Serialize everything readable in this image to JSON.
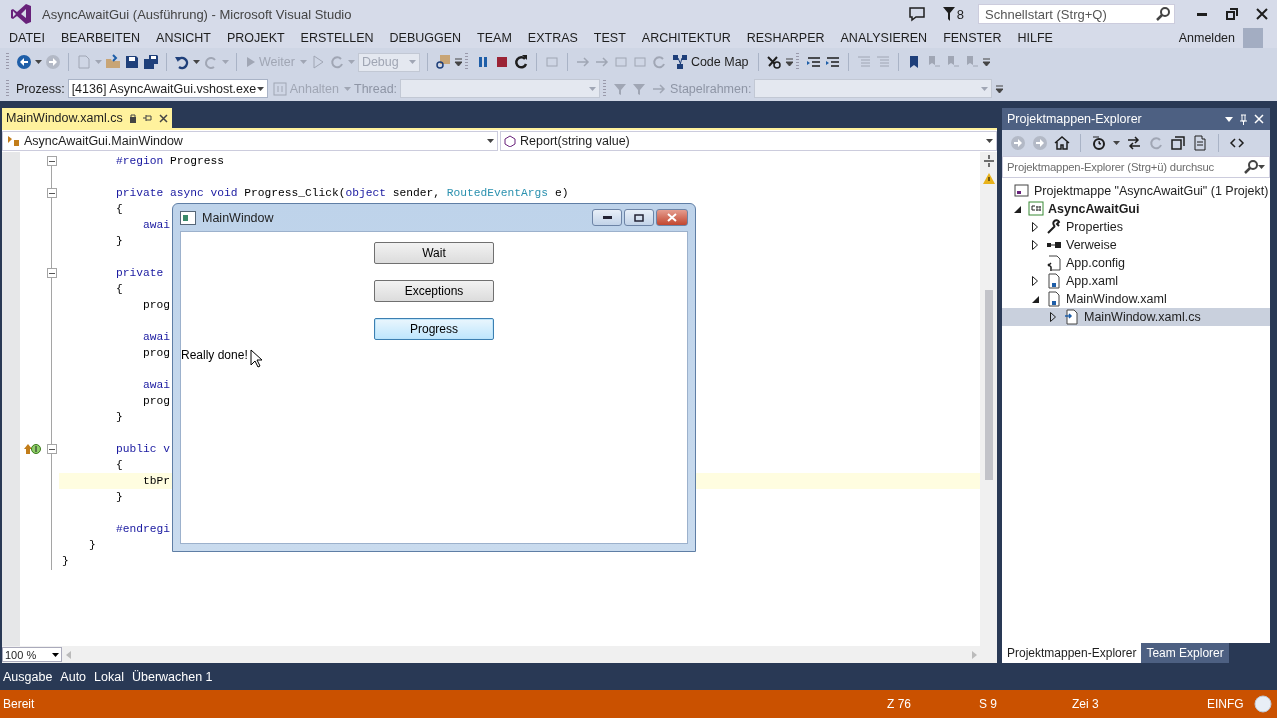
{
  "window": {
    "title": "AsyncAwaitGui (Ausführung) - Microsoft Visual Studio",
    "notification_count": "8",
    "quick_launch": {
      "placeholder": "Schnellstart (Strg+Q)"
    }
  },
  "menu": [
    "DATEI",
    "BEARBEITEN",
    "ANSICHT",
    "PROJEKT",
    "ERSTELLEN",
    "DEBUGGEN",
    "TEAM",
    "EXTRAS",
    "TEST",
    "ARCHITEKTUR",
    "RESHARPER",
    "ANALYSIEREN",
    "FENSTER",
    "HILFE"
  ],
  "account": {
    "label": "Anmelden"
  },
  "toolbar": {
    "continue_button": {
      "label": "Weiter",
      "disabled": true
    },
    "config_combo": {
      "value": "Debug",
      "disabled": true
    },
    "code_map_button": {
      "label": "Code Map",
      "disabled": false
    }
  },
  "debug_location": {
    "process_label": "Prozess:",
    "process_combo": "[4136] AsyncAwaitGui.vshost.exe",
    "suspend_button": {
      "label": "Anhalten",
      "disabled": true
    },
    "thread_label": "Thread:",
    "stack_frame_label": "Stapelrahmen:"
  },
  "editor": {
    "tab": {
      "title": "MainWindow.xaml.cs",
      "selected": true
    },
    "type_combo": "AsyncAwaitGui.MainWindow",
    "member_combo": "Report(string value)",
    "zoom": "100 %",
    "lines": [
      {
        "tokens": [
          {
            "kind": "keyword",
            "text": "        #region"
          },
          {
            "kind": "plain",
            "text": " Progress"
          }
        ],
        "fold": true,
        "highlighted": false
      },
      {
        "tokens": [
          {
            "kind": "keyword",
            "text": "        private async void"
          },
          {
            "kind": "plain",
            "text": " Progress_Click("
          },
          {
            "kind": "keyword",
            "text": "object"
          },
          {
            "kind": "plain",
            "text": " sender, "
          },
          {
            "kind": "type",
            "text": "RoutedEventArgs"
          },
          {
            "kind": "plain",
            "text": " e)"
          }
        ],
        "fold": true,
        "highlighted": false,
        "space_before": true
      },
      {
        "tokens": [
          {
            "kind": "plain",
            "text": "        {"
          }
        ],
        "fold": false,
        "highlighted": false
      },
      {
        "tokens": [
          {
            "kind": "keyword",
            "text": "            awai"
          }
        ],
        "fold": false,
        "highlighted": false
      },
      {
        "tokens": [
          {
            "kind": "plain",
            "text": "        }"
          }
        ],
        "fold": false,
        "highlighted": false
      },
      {
        "tokens": [
          {
            "kind": "keyword",
            "text": "        private"
          }
        ],
        "fold": true,
        "highlighted": false,
        "space_before": true
      },
      {
        "tokens": [
          {
            "kind": "plain",
            "text": "        {"
          }
        ],
        "fold": false,
        "highlighted": false
      },
      {
        "tokens": [
          {
            "kind": "plain",
            "text": "            prog"
          }
        ],
        "fold": false,
        "highlighted": false
      },
      {
        "tokens": [
          {
            "kind": "keyword",
            "text": "            awai"
          }
        ],
        "fold": false,
        "highlighted": false,
        "space_before": true
      },
      {
        "tokens": [
          {
            "kind": "plain",
            "text": "            prog"
          }
        ],
        "fold": false,
        "highlighted": false
      },
      {
        "tokens": [
          {
            "kind": "keyword",
            "text": "            awai"
          }
        ],
        "fold": false,
        "highlighted": false,
        "space_before": true
      },
      {
        "tokens": [
          {
            "kind": "plain",
            "text": "            prog"
          }
        ],
        "fold": false,
        "highlighted": false
      },
      {
        "tokens": [
          {
            "kind": "plain",
            "text": "        }"
          }
        ],
        "fold": false,
        "highlighted": false
      },
      {
        "tokens": [
          {
            "kind": "keyword",
            "text": "        public v"
          }
        ],
        "fold": true,
        "highlighted": false,
        "implements_marker": true,
        "space_before": true
      },
      {
        "tokens": [
          {
            "kind": "plain",
            "text": "        {"
          }
        ],
        "fold": false,
        "highlighted": false
      },
      {
        "tokens": [
          {
            "kind": "plain",
            "text": "            tbPr"
          }
        ],
        "fold": false,
        "highlighted": true
      },
      {
        "tokens": [
          {
            "kind": "plain",
            "text": "        }"
          }
        ],
        "fold": false,
        "highlighted": false
      },
      {
        "tokens": [
          {
            "kind": "keyword",
            "text": "        #endregi"
          }
        ],
        "fold": false,
        "highlighted": false,
        "space_before": true
      },
      {
        "tokens": [
          {
            "kind": "plain",
            "text": "    }"
          }
        ],
        "fold": false,
        "highlighted": false
      },
      {
        "tokens": [
          {
            "kind": "plain",
            "text": "}"
          }
        ],
        "fold": false,
        "highlighted": false
      }
    ]
  },
  "app_window": {
    "title": "MainWindow",
    "buttons": [
      {
        "label": "Wait",
        "focused": false
      },
      {
        "label": "Exceptions",
        "focused": false
      },
      {
        "label": "Progress",
        "focused": true
      }
    ],
    "status_text": "Really done!"
  },
  "solution_explorer": {
    "title": "Projektmappen-Explorer",
    "search": {
      "placeholder": "Projektmappen-Explorer (Strg+ü) durchsuc"
    },
    "tree": [
      {
        "label": "Projektmappe \"AsyncAwaitGui\" (1 Projekt)",
        "kind": "solution",
        "selected": false,
        "children": [
          {
            "label": "AsyncAwaitGui",
            "kind": "project",
            "expanded": true,
            "selected": false,
            "children": [
              {
                "label": "Properties",
                "kind": "properties",
                "expanded": false,
                "selected": false
              },
              {
                "label": "Verweise",
                "kind": "references",
                "expanded": false,
                "selected": false
              },
              {
                "label": "App.config",
                "kind": "config",
                "selected": false
              },
              {
                "label": "App.xaml",
                "kind": "xaml",
                "expanded": false,
                "selected": false
              },
              {
                "label": "MainWindow.xaml",
                "kind": "xaml",
                "expanded": true,
                "selected": false,
                "children": [
                  {
                    "label": "MainWindow.xaml.cs",
                    "kind": "code",
                    "expanded": false,
                    "selected": true
                  }
                ]
              }
            ]
          }
        ]
      }
    ],
    "tabs": [
      {
        "label": "Projektmappen-Explorer",
        "selected": true
      },
      {
        "label": "Team Explorer",
        "selected": false
      }
    ]
  },
  "tool_tabs": [
    "Ausgabe",
    "Auto",
    "Lokal",
    "Überwachen 1"
  ],
  "status_bar": {
    "message": "Bereit",
    "line": "Z 76",
    "column": "S 9",
    "char": "Zei 3",
    "mode": "EINFG"
  }
}
